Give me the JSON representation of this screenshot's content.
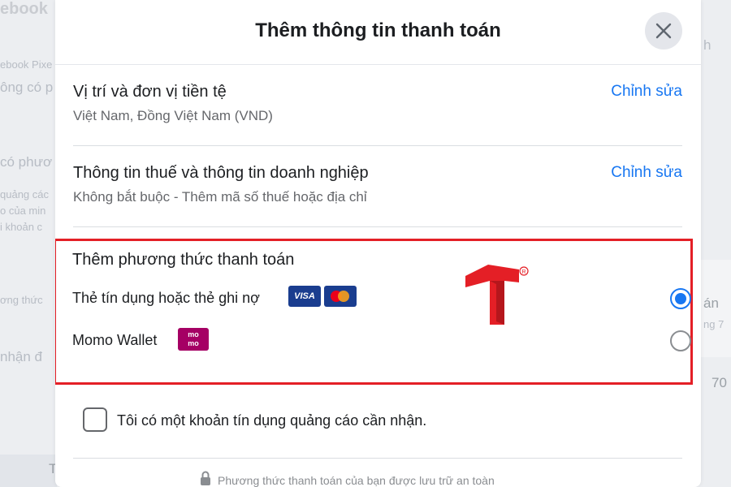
{
  "background": {
    "snippets": [
      {
        "text": "ebook"
      },
      {
        "text": "ebook Pixe"
      },
      {
        "text": "ông có p"
      },
      {
        "text": "có phươ"
      },
      {
        "text": "quảng các"
      },
      {
        "text": "o của min"
      },
      {
        "text": "i khoản c"
      },
      {
        "text": "ơng thức"
      },
      {
        "text": "nhận đ"
      },
      {
        "text": "h"
      },
      {
        "text": "án"
      },
      {
        "text": "ng 7"
      },
      {
        "text": "70"
      },
      {
        "text": "T"
      }
    ]
  },
  "modal": {
    "title": "Thêm thông tin thanh toán",
    "close_icon": "close-icon",
    "sections": [
      {
        "title": "Vị trí và đơn vị tiền tệ",
        "subtitle": "Việt Nam, Đồng Việt Nam (VND)",
        "edit_label": "Chỉnh sửa"
      },
      {
        "title": "Thông tin thuế và thông tin doanh nghiệp",
        "subtitle": "Không bắt buộc - Thêm mã số thuế hoặc địa chỉ",
        "edit_label": "Chỉnh sửa"
      }
    ],
    "payment": {
      "title": "Thêm phương thức thanh toán",
      "highlight_color": "#e41f26",
      "options": [
        {
          "label": "Thẻ tín dụng hoặc thẻ ghi nợ",
          "selected": true,
          "badges": [
            "VISA",
            "mastercard-icon"
          ]
        },
        {
          "label": "Momo Wallet",
          "selected": false,
          "badges": [
            "mo mo"
          ]
        }
      ]
    },
    "credit_checkbox": {
      "label": "Tôi có một khoản tín dụng quảng cáo cần nhận.",
      "checked": false
    },
    "footer_note": "Phương thức thanh toán của bạn được lưu trữ an toàn"
  },
  "colors": {
    "accent": "#1877f2",
    "highlight": "#e41f26",
    "logo": "#e41f26"
  }
}
